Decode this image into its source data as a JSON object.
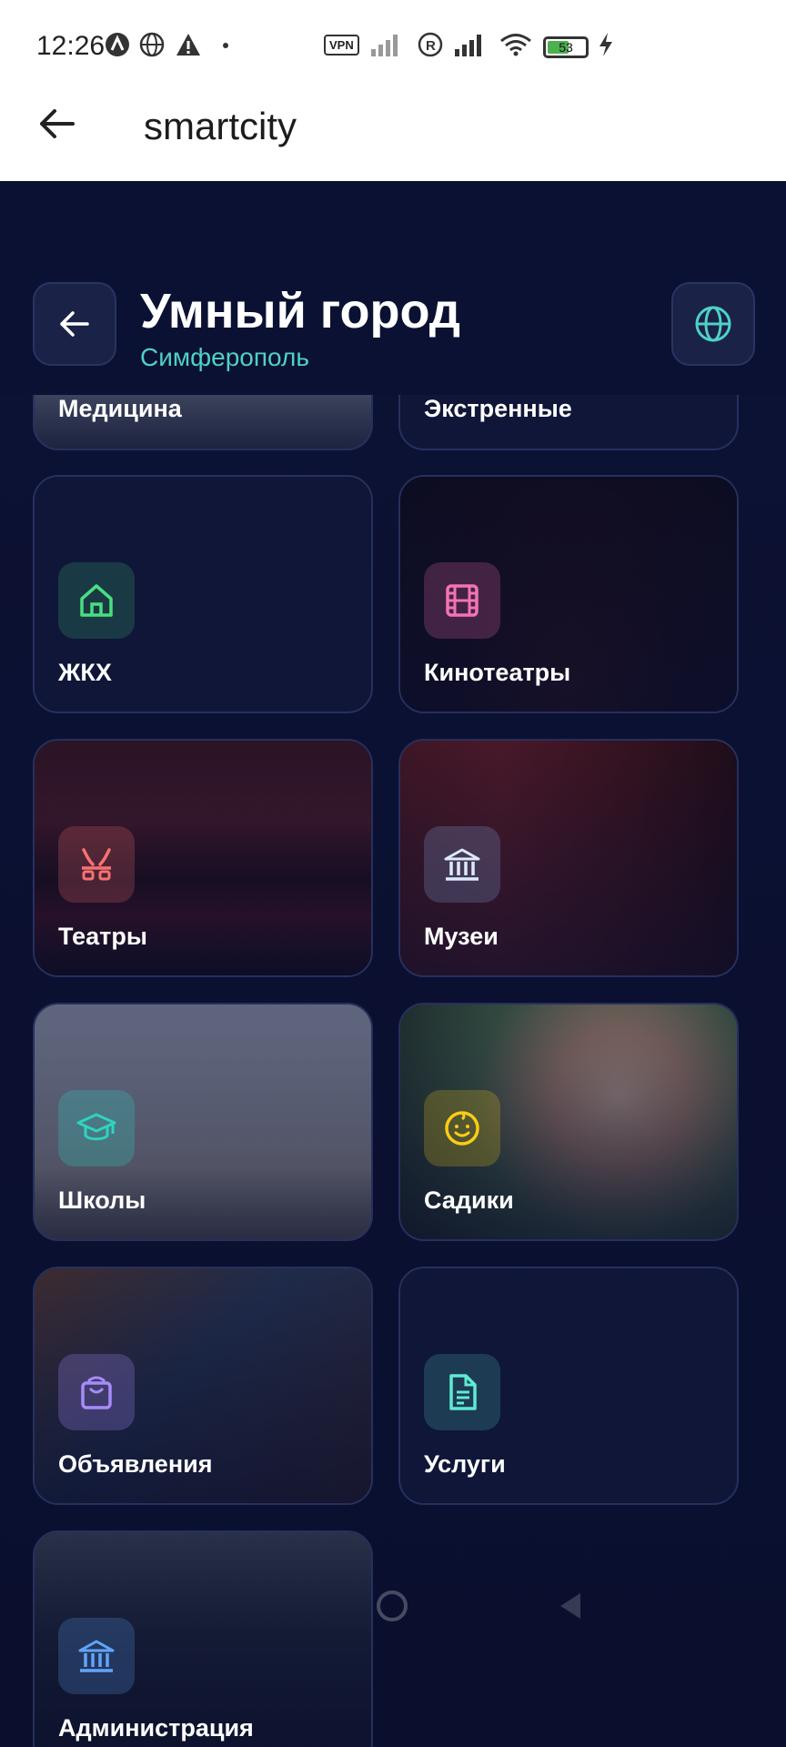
{
  "status_bar": {
    "time": "12:26",
    "vpn": "VPN",
    "battery": "53"
  },
  "app_bar": {
    "title": "smartcity"
  },
  "header": {
    "title": "Умный город",
    "subtitle": "Симферополь"
  },
  "categories": [
    {
      "label": "Медицина",
      "icon": "medical-icon"
    },
    {
      "label": "Экстренные",
      "icon": "emergency-icon"
    },
    {
      "label": "ЖКХ",
      "icon": "home-icon",
      "icon_color": "#4ade80"
    },
    {
      "label": "Кинотеатры",
      "icon": "film-icon",
      "icon_color": "#f472b6"
    },
    {
      "label": "Театры",
      "icon": "theater-masks-icon",
      "icon_color": "#f87171"
    },
    {
      "label": "Музеи",
      "icon": "museum-icon",
      "icon_color": "#93c5fd"
    },
    {
      "label": "Школы",
      "icon": "graduation-cap-icon",
      "icon_color": "#2dd4bf"
    },
    {
      "label": "Садики",
      "icon": "baby-face-icon",
      "icon_color": "#facc15"
    },
    {
      "label": "Объявления",
      "icon": "shopping-bag-icon",
      "icon_color": "#a78bfa"
    },
    {
      "label": "Услуги",
      "icon": "document-icon",
      "icon_color": "#5eead4"
    },
    {
      "label": "Администрация",
      "icon": "government-icon",
      "icon_color": "#60a5fa"
    }
  ],
  "colors": {
    "background": "#0b0f2e",
    "accent": "#4fd1c5",
    "card_border": "#27305d"
  }
}
